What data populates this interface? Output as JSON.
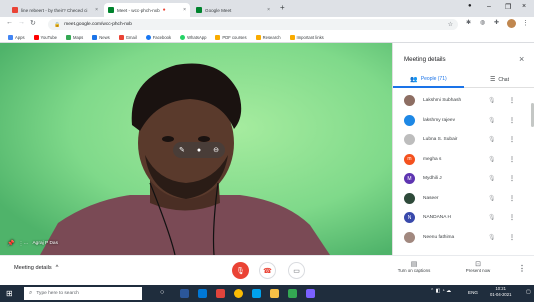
{
  "browser": {
    "tabs": [
      {
        "label": "line rebeert - by their? Checed ci",
        "active": false
      },
      {
        "label": "Meet - wcc-phch-nxb",
        "active": true
      },
      {
        "label": "Google Meet",
        "active": false
      }
    ],
    "new_tab": "+",
    "url": "meet.google.com/wcc-phch-nxb",
    "bookmarks": [
      "Apps",
      "YouTube",
      "Maps",
      "News",
      "Gmail",
      "Facebook",
      "WhatsApp",
      "PDF courses",
      "Research",
      "Important links"
    ]
  },
  "video": {
    "presenter_name": "Agraj P Das",
    "tile_icons": [
      "pin-icon",
      "mic-icon",
      "remove-icon"
    ]
  },
  "panel": {
    "title": "Meeting details",
    "close": "×",
    "tabs": {
      "people": "People (71)",
      "chat": "Chat"
    },
    "participants": [
      {
        "name": "Lakshmi Subhash",
        "initial": "",
        "color": "#8d6e63"
      },
      {
        "name": "lakshmy rajeev",
        "initial": "",
        "color": "#1e88e5"
      },
      {
        "name": "Lubna S. Subair",
        "initial": "",
        "color": "#bdbdbd"
      },
      {
        "name": "megha s",
        "initial": "m",
        "color": "#f4511e"
      },
      {
        "name": "Mydhili J",
        "initial": "M",
        "color": "#5e35b1"
      },
      {
        "name": "Naseer",
        "initial": "",
        "color": "#2e4a3a"
      },
      {
        "name": "NANDANA H",
        "initial": "N",
        "color": "#3949ab"
      },
      {
        "name": "Neenu fathima",
        "initial": "",
        "color": "#a1887f"
      }
    ]
  },
  "controls": {
    "meeting_details": "Meeting details",
    "captions_label": "Turn on captions",
    "present_label": "Present now"
  },
  "taskbar": {
    "search_placeholder": "Type here to search",
    "tray_lang": "ENG",
    "time": "10:21",
    "date": "01-04-2021"
  },
  "colors": {
    "accent": "#1a73e8",
    "danger": "#ea4335",
    "video_bg": "#7ed98a"
  }
}
